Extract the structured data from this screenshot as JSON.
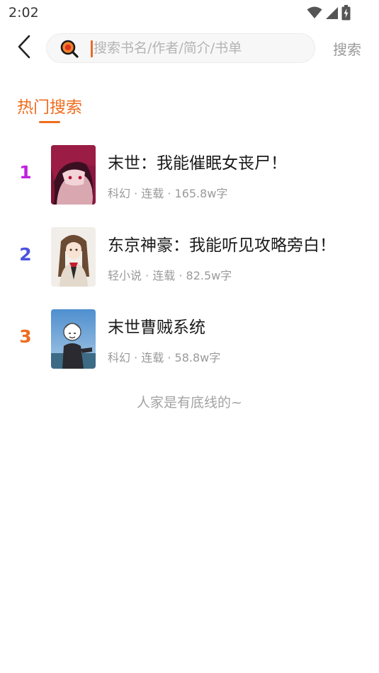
{
  "status_bar": {
    "time": "2:02"
  },
  "search": {
    "placeholder": "搜索书名/作者/简介/书单",
    "value": "",
    "submit_label": "搜索"
  },
  "hot": {
    "title": "热门搜索",
    "accent_color": "#ef6c1d",
    "books": [
      {
        "rank": "1",
        "rank_color": "#c21ee0",
        "title": "末世：我能催眠女丧尸！",
        "meta": "科幻 · 连载 · 165.8w字",
        "cover": "anime-girl-red-hair"
      },
      {
        "rank": "2",
        "rank_color": "#4b52e0",
        "title": "东京神豪：我能听见攻略旁白！",
        "meta": "轻小说 · 连载 · 82.5w字",
        "cover": "anime-girl-brown-hair-uniform"
      },
      {
        "rank": "3",
        "rank_color": "#ef6c1d",
        "title": "末世曹贼系统",
        "meta": "科幻 · 连载 · 58.8w字",
        "cover": "meme-character-blue-sky"
      }
    ]
  },
  "footer": {
    "note": "人家是有底线的~"
  }
}
